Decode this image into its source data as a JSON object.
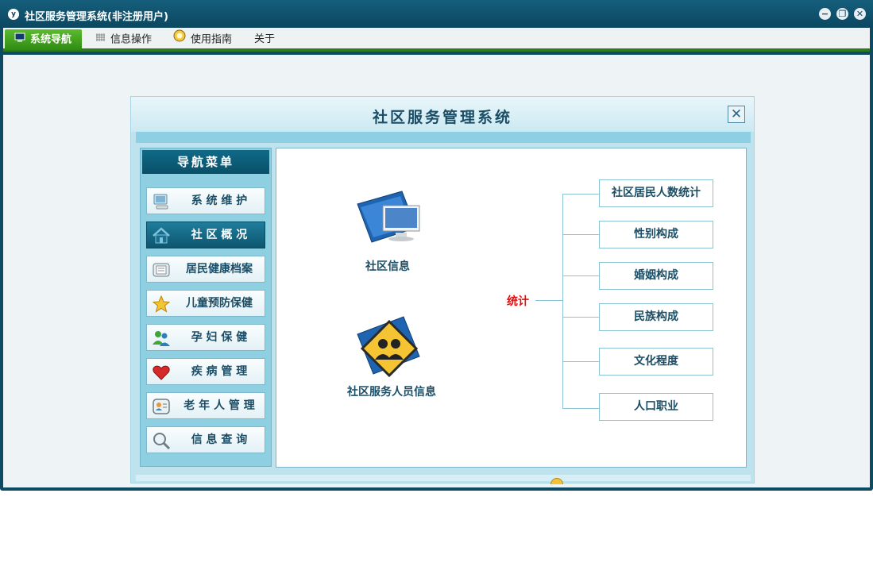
{
  "window": {
    "title": "社区服务管理系统(非注册用户)",
    "app_icon": "y"
  },
  "menubar": {
    "items": [
      {
        "label": "系统导航",
        "icon": "monitor-icon",
        "active": true
      },
      {
        "label": "信息操作",
        "icon": "grid-icon",
        "active": false
      },
      {
        "label": "使用指南",
        "icon": "info-icon",
        "active": false
      },
      {
        "label": "关于",
        "icon": "",
        "active": false
      }
    ]
  },
  "dialog": {
    "title": "社区服务管理系统",
    "close": "✕"
  },
  "nav": {
    "title": "导航菜单",
    "items": [
      {
        "label": "系 统 维 护",
        "icon": "computer-icon"
      },
      {
        "label": "社 区 概 况",
        "icon": "home-icon",
        "active": true
      },
      {
        "label": "居民健康档案",
        "icon": "file-cabinet-icon"
      },
      {
        "label": "儿童预防保健",
        "icon": "star-icon"
      },
      {
        "label": "孕 妇 保 健",
        "icon": "users-icon"
      },
      {
        "label": "疾 病 管 理",
        "icon": "heart-icon"
      },
      {
        "label": "老 年 人 管 理",
        "icon": "contact-card-icon"
      },
      {
        "label": "信 息 查 询",
        "icon": "magnifier-icon"
      }
    ]
  },
  "content": {
    "community_info_label": "社区信息",
    "staff_info_label": "社区服务人员信息",
    "stats_label": "统计",
    "stats": [
      "社区居民人数统计",
      "性别构成",
      "婚姻构成",
      "民族构成",
      "文化程度",
      "人口职业"
    ]
  },
  "colors": {
    "title_bar": "#0c4760",
    "menu_active": "#3a9a1c",
    "nav_active": "#0d5670",
    "stats_label": "#e01010"
  }
}
